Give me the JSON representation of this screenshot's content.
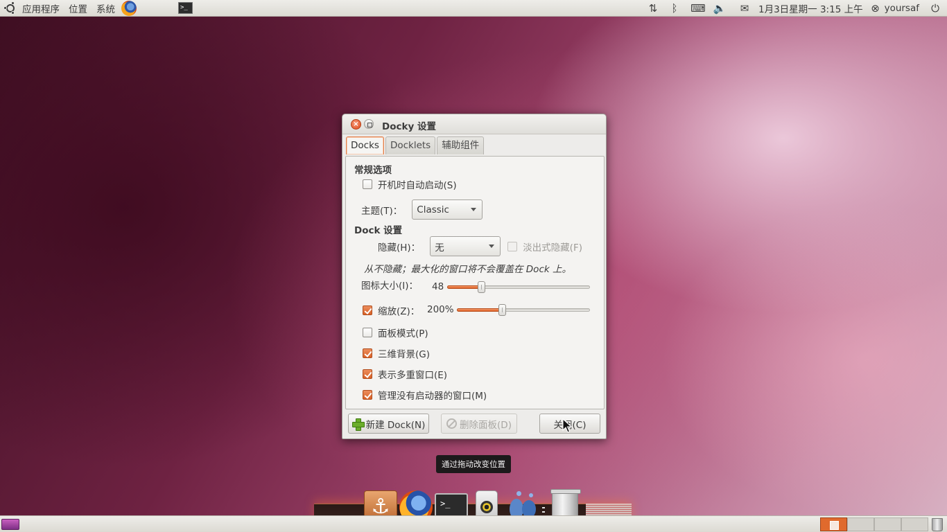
{
  "top_panel": {
    "menus": [
      "应用程序",
      "位置",
      "系统"
    ],
    "clock": "1月3日星期一  3:15 上午",
    "username": "yoursaf",
    "icons": [
      "ubuntu-logo",
      "firefox-icon",
      "terminal-icon",
      "network-icon",
      "bluetooth-icon",
      "keyboard-icon",
      "volume-icon",
      "mail-icon",
      "user-status-icon",
      "power-icon"
    ]
  },
  "dialog": {
    "title": "Docky 设置",
    "tabs": [
      "Docks",
      "Docklets",
      "辅助组件"
    ],
    "active_tab": "Docks",
    "general": {
      "heading": "常规选项",
      "autostart_label": "开机时自动启动(S)",
      "autostart_checked": false,
      "theme_label": "主题(T)：",
      "theme_value": "Classic"
    },
    "dock": {
      "heading": "Dock 设置",
      "hide_label": "隐藏(H)：",
      "hide_value": "无",
      "fade_label": "淡出式隐藏(F)",
      "fade_checked": false,
      "note": "从不隐藏；最大化的窗口将不会覆盖在 Dock 上。",
      "icon_size_label": "图标大小(I)：",
      "icon_size_value": "48",
      "icon_size_fraction": 0.24,
      "zoom_label": "缩放(Z)：",
      "zoom_value": "200%",
      "zoom_checked": true,
      "zoom_fraction": 0.34,
      "panel_mode_label": "面板模式(P)",
      "panel_mode_checked": false,
      "threed_label": "三维背景(G)",
      "threed_checked": true,
      "multi_window_label": "表示多重窗口(E)",
      "multi_window_checked": true,
      "manage_label": "管理没有启动器的窗口(M)",
      "manage_checked": true
    },
    "buttons": {
      "new_dock": "新建 Dock(N)",
      "delete_panel": "删除面板(D)",
      "close": "关闭(C)"
    }
  },
  "tooltip": "通过拖动改变位置",
  "dock_items": [
    "anchor-icon",
    "firefox-icon",
    "terminal-icon",
    "speaker-icon",
    "pidgin-icon",
    "trash-icon"
  ],
  "colors": {
    "accent": "#dd6a2e",
    "panel": "#e6e4df",
    "dialog_bg": "#edecea"
  }
}
